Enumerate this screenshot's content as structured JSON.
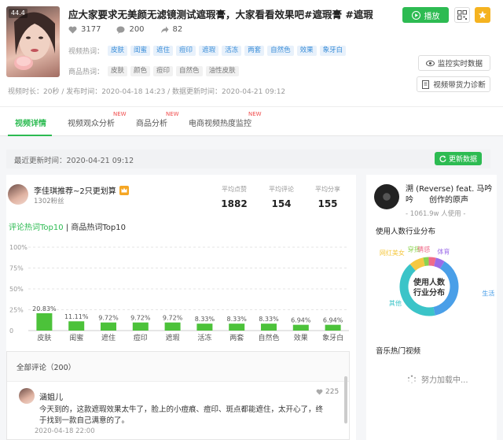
{
  "video": {
    "badge": "44.4",
    "title": "应大家要求无美颜无滤镜测试遮瑕膏，大家看看效果吧#遮瑕膏 #遮瑕",
    "likes": "3177",
    "comments": "200",
    "shares": "82",
    "video_hot_label": "视频热词：",
    "video_hot_words": [
      "皮肤",
      "闺蜜",
      "遮住",
      "痘印",
      "遮瑕",
      "活冻",
      "两套",
      "自然色",
      "效果",
      "象牙白"
    ],
    "product_hot_label": "商品热词：",
    "product_hot_words": [
      "皮肤",
      "颜色",
      "痘印",
      "自然色",
      "油性皮肤"
    ],
    "meta": "视频时长：20秒 / 发布时间：2020-04-18 14:23 / 数据更新时间：2020-04-21 09:12"
  },
  "actions": {
    "play": "播放",
    "monitor": "监控实时数据",
    "diagnose": "视频带货力诊断"
  },
  "tabs": [
    {
      "label": "视频详情",
      "new": ""
    },
    {
      "label": "视频观众分析",
      "new": "NEW"
    },
    {
      "label": "商品分析",
      "new": "NEW"
    },
    {
      "label": "电商视频热度监控",
      "new": "NEW"
    }
  ],
  "update": {
    "text": "最近更新时间：2020-04-21 09:12",
    "button": "更新数据"
  },
  "author": {
    "name": "李佳琪推荐~2只更划算",
    "fans": "1302粉丝"
  },
  "kpis": [
    {
      "label": "平均点赞",
      "value": "1882"
    },
    {
      "label": "平均评论",
      "value": "154"
    },
    {
      "label": "平均分享",
      "value": "155"
    }
  ],
  "keywords_tabs": {
    "active": "评论热词Top10",
    "separator": "|",
    "inactive": "商品热词Top10"
  },
  "chart_data": {
    "type": "bar",
    "categories": [
      "皮肤",
      "闺蜜",
      "遮住",
      "痘印",
      "遮瑕",
      "活冻",
      "两套",
      "自然色",
      "效果",
      "象牙白"
    ],
    "values": [
      20.83,
      11.11,
      9.72,
      9.72,
      9.72,
      8.33,
      8.33,
      8.33,
      6.94,
      6.94
    ],
    "labels": [
      "20.83%",
      "11.11%",
      "9.72%",
      "9.72%",
      "9.72%",
      "8.33%",
      "8.33%",
      "8.33%",
      "6.94%",
      "6.94%"
    ],
    "ylim": [
      0,
      100
    ],
    "yticks": [
      "0",
      "25%",
      "50%",
      "75%",
      "100%"
    ],
    "grid": true,
    "color": "#4cc23a"
  },
  "comments": {
    "header": "全部评论（200）",
    "items": [
      {
        "name": "涵姐儿",
        "likes": "225",
        "text": "今天到的，这款遮瑕效果太牛了，脸上的小痘痕、痘印、斑点都能遮住，太开心了，终于找到一款自己满意的了。",
        "date": "2020-04-18 22:00"
      }
    ]
  },
  "music": {
    "name": "溯 (Reverse) feat. 马吟吟　　创作的原声",
    "used": "- 1061.9w 人使用 -"
  },
  "industry": {
    "title": "使用人数行业分布",
    "center": [
      "使用人数",
      "行业分布"
    ],
    "segments": [
      {
        "name": "生活",
        "value": 38,
        "color": "#4a9fe8"
      },
      {
        "name": "其他",
        "value": 42,
        "color": "#3bc4c8"
      },
      {
        "name": "网红美女",
        "value": 8,
        "color": "#f5c842"
      },
      {
        "name": "穿搭",
        "value": 3,
        "color": "#8bd34f"
      },
      {
        "name": "情感",
        "value": 4,
        "color": "#f06b8a"
      },
      {
        "name": "体育",
        "value": 5,
        "color": "#9b6be8"
      }
    ]
  },
  "hot_music": {
    "title": "音乐热门视频",
    "loading": "努力加载中..."
  },
  "colors": {
    "accent": "#2dbb52",
    "tag_blue": "#3b8ed8",
    "new_red": "#f04b4b"
  }
}
